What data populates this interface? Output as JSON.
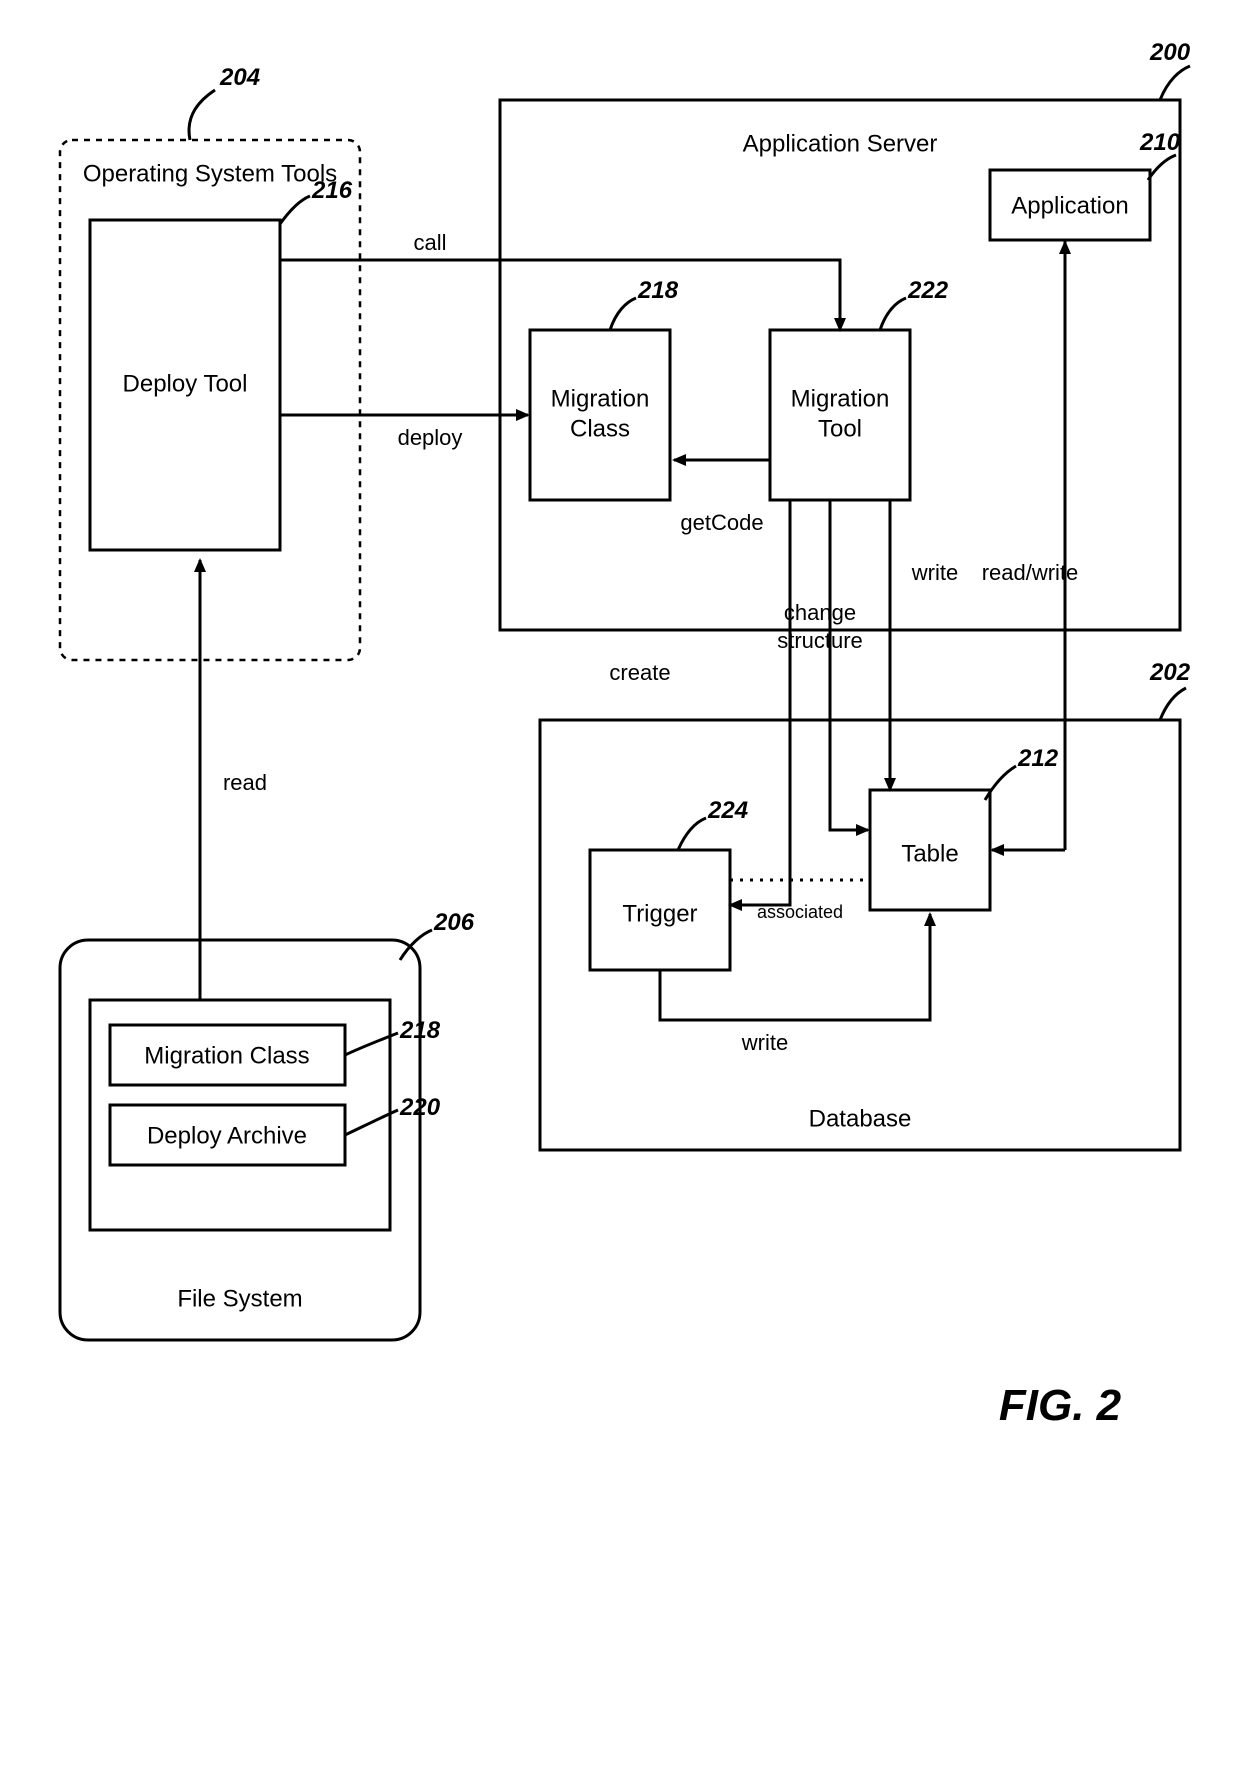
{
  "figureLabel": "FIG. 2",
  "boxes": {
    "deployTool": {
      "label": "Deploy Tool",
      "ref": "216"
    },
    "migrationClassAS": {
      "line1": "Migration",
      "line2": "Class",
      "ref": "218"
    },
    "migrationTool": {
      "line1": "Migration",
      "line2": "Tool",
      "ref": "222"
    },
    "application": {
      "label": "Application",
      "ref": "210"
    },
    "trigger": {
      "label": "Trigger",
      "ref": "224"
    },
    "table": {
      "label": "Table",
      "ref": "212"
    },
    "migrationClassFS": {
      "label": "Migration Class",
      "ref": "218"
    },
    "deployArchive": {
      "label": "Deploy Archive",
      "ref": "220"
    }
  },
  "containers": {
    "osTools": {
      "label": "Operating System Tools",
      "ref": "204"
    },
    "appServer": {
      "label": "Application Server",
      "ref": "200"
    },
    "database": {
      "label": "Database",
      "ref": "202"
    },
    "fileSystem": {
      "label": "File System",
      "ref": "206"
    }
  },
  "edges": {
    "read": "read",
    "call": "call",
    "deploy": "deploy",
    "getCode": "getCode",
    "create": "create",
    "changeStructure1": "change",
    "changeStructure2": "structure",
    "write": "write",
    "readWrite": "read/write",
    "associated": "associated",
    "writeTrigger": "write"
  }
}
